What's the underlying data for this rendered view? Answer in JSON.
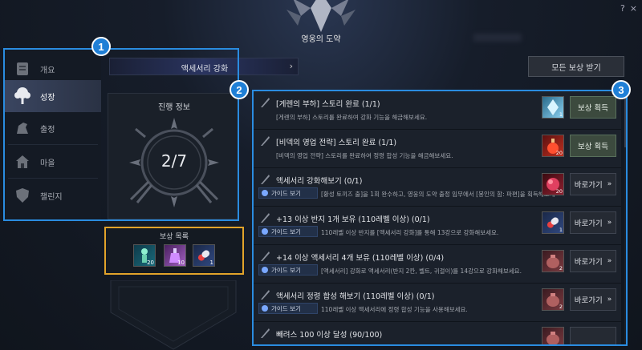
{
  "window": {
    "title": "영웅의 도약",
    "help_label": "?",
    "close_label": "×"
  },
  "sidebar": {
    "items": [
      {
        "label": "개요",
        "icon": "scroll-icon"
      },
      {
        "label": "성장",
        "icon": "tree-icon"
      },
      {
        "label": "출정",
        "icon": "horse-icon"
      },
      {
        "label": "마을",
        "icon": "house-icon"
      },
      {
        "label": "챌린지",
        "icon": "shield-icon"
      }
    ],
    "active_index": 1
  },
  "tabbar": {
    "label": "액세서리 강화",
    "arrow": "›"
  },
  "claim_all_label": "모든 보상 받기",
  "progress": {
    "title": "진행 정보",
    "count": "2/7"
  },
  "rewards": {
    "title": "보상 목록",
    "items": [
      {
        "icon": "buff-icon",
        "count": "20"
      },
      {
        "icon": "potion-icon",
        "count": "10"
      },
      {
        "icon": "capsule-icon",
        "count": "1"
      }
    ]
  },
  "quests": [
    {
      "title": "[게렌의 부하] 스토리 완료 (1/1)",
      "desc": "[게렌의 부하] 스토리를 완료하여 강화 기능을 해금해보세요.",
      "guide": null,
      "item_icon": "crystal-icon",
      "item_count": "1",
      "action": "보상 획득",
      "action_type": "reward"
    },
    {
      "title": "[비덱의 영업 전략] 스토리 완료 (1/1)",
      "desc": "[비덱의 영업 전략] 스토리를 완료하여 정령 합성 기능을 해금해보세요.",
      "guide": null,
      "item_icon": "potion-red-icon",
      "item_count": "20",
      "action": "보상 획득",
      "action_type": "reward"
    },
    {
      "title": "액세서리 강화해보기 (0/1)",
      "desc": "[황성 토끼즈 출]을 1회 완수하고, 영웅의 도약 출정 임무에서 [봉인의 함: 파편]을 획득해보세요.",
      "guide": "가이드 보기",
      "item_icon": "ore-icon",
      "item_count": "20",
      "action": "바로가기",
      "action_type": "goto"
    },
    {
      "title": "+13 이상 반지 1개 보유 (110레벨 이상) (0/1)",
      "desc": "110레벨 이상 반지를 [액세서리 강화]를 통해 13강으로 강화해보세요.",
      "guide": "가이드 보기",
      "item_icon": "capsule-icon",
      "item_count": "1",
      "action": "바로가기",
      "action_type": "goto"
    },
    {
      "title": "+14 이상 액세서리 4개 보유 (110레벨 이상) (0/4)",
      "desc": "[액세서리] 강화로 액세서리(반지 2칸, 벨트, 귀걸이)를 14강으로 강화해보세요.",
      "guide": "가이드 보기",
      "item_icon": "pouch-icon",
      "item_count": "2",
      "action": "바로가기",
      "action_type": "goto"
    },
    {
      "title": "액세서리 정령 합성 해보기 (110레벨 이상) (0/1)",
      "desc": "110레벨 이상 액세서리에 정령 합성 기능을 사용해보세요.",
      "guide": "가이드 보기",
      "item_icon": "pouch-icon",
      "item_count": "2",
      "action": "바로가기",
      "action_type": "goto"
    },
    {
      "title": "빼려스 100 이상 달성 (90/100)",
      "desc": "",
      "guide": null,
      "item_icon": "pouch-icon",
      "item_count": "",
      "action": "",
      "action_type": "goto"
    }
  ],
  "annotations": [
    {
      "number": "1"
    },
    {
      "number": "2"
    },
    {
      "number": "3"
    }
  ],
  "colors": {
    "highlight": "#2a8ce0",
    "rewards_border": "#e2a32a",
    "reward_button": "#3c4a3e"
  }
}
